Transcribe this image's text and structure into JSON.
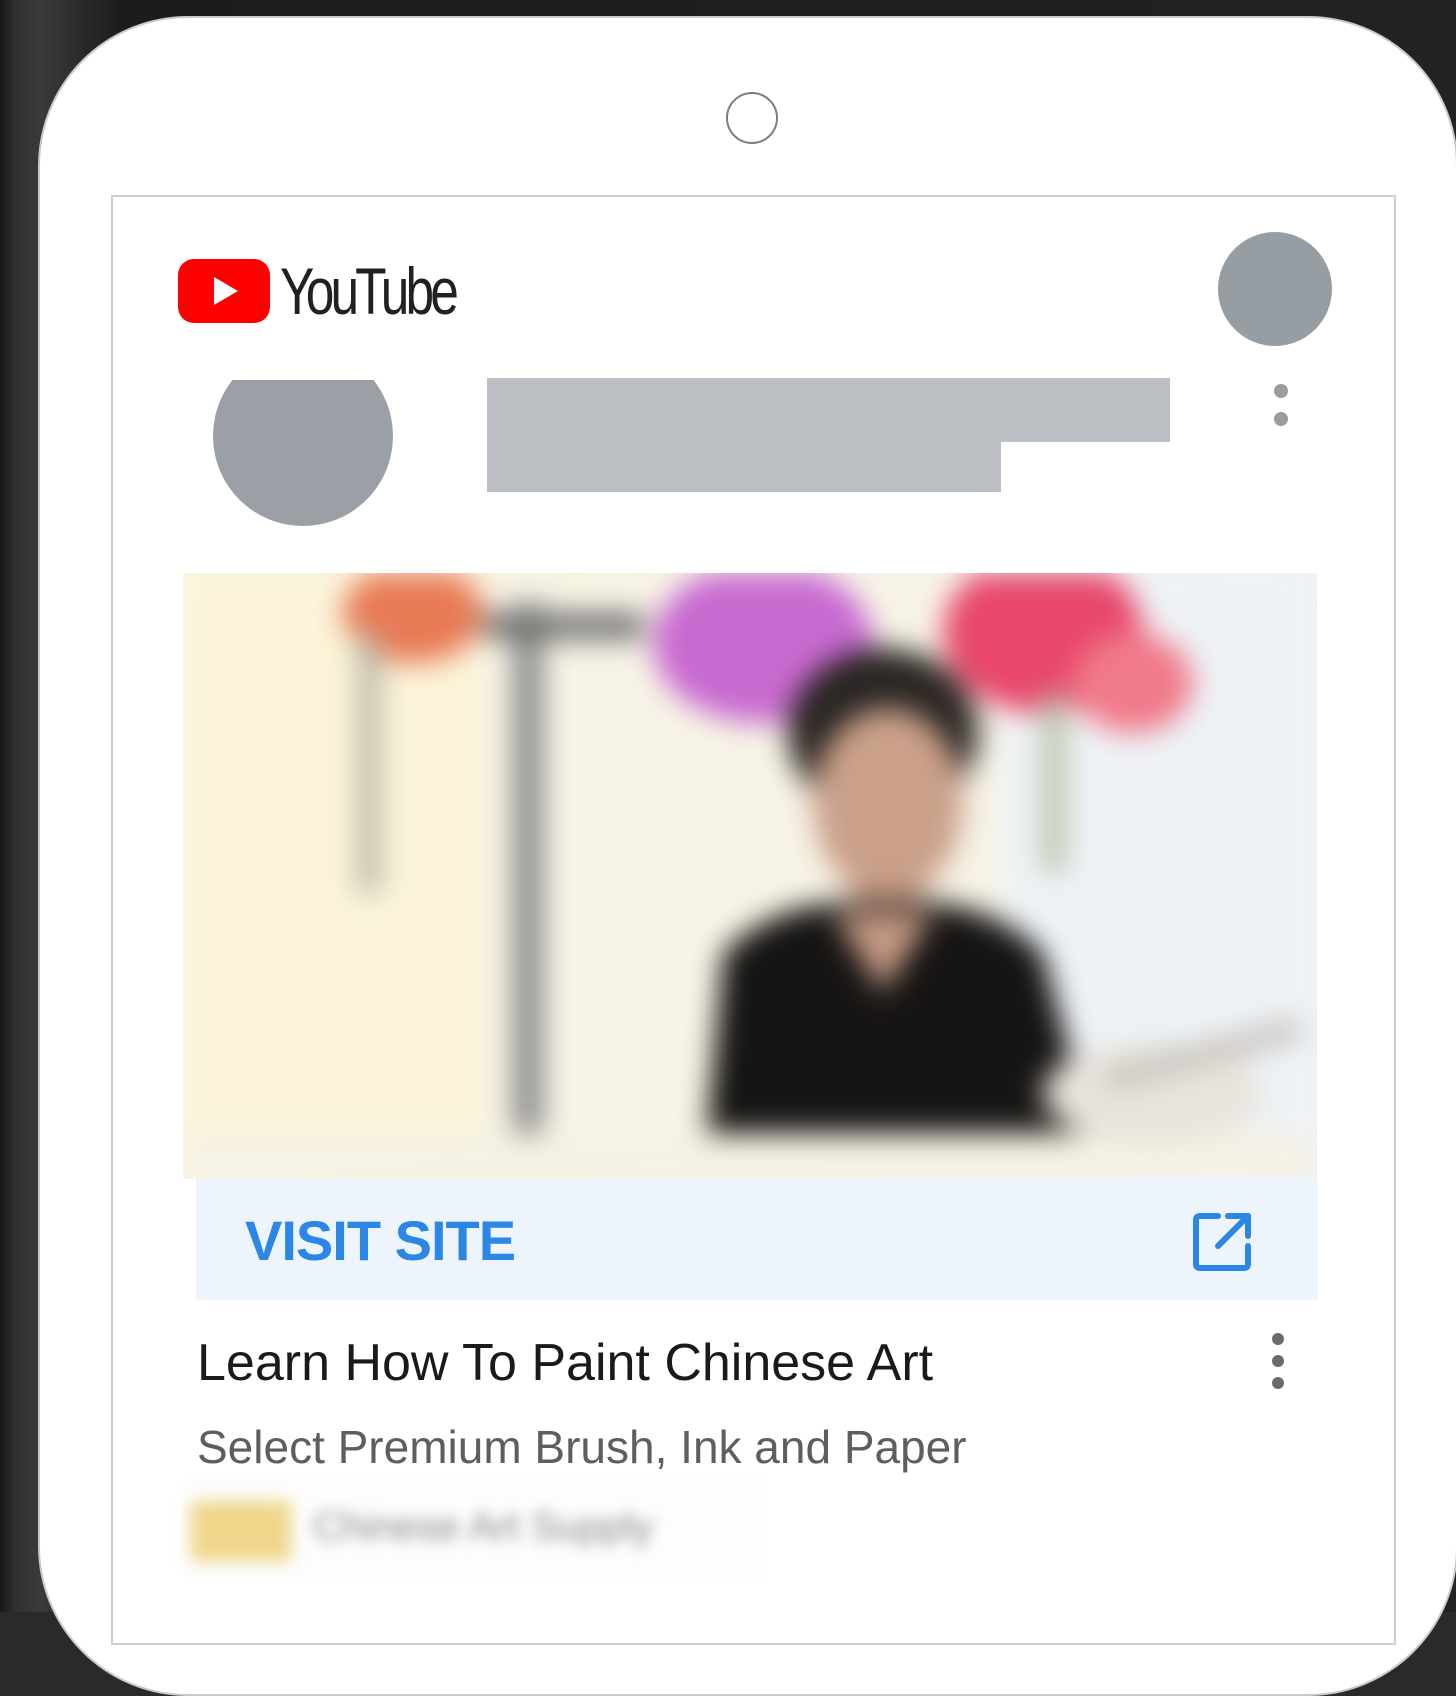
{
  "header": {
    "logo_text": "YouTube"
  },
  "ad": {
    "cta_label": "VISIT SITE",
    "title": "Learn How To Paint Chinese Art",
    "description": "Select Premium Brush, Ink and Paper",
    "advertiser_name": "Chinese Art Supply"
  },
  "colors": {
    "cta_text": "#2b86e6",
    "cta_background": "#eef4fb",
    "youtube_red": "#ff0000",
    "placeholder_gray": "#bcc0c4"
  },
  "icons": {
    "open_external": "external-link-icon",
    "more_menu": "more-vert-icon",
    "play": "play-icon"
  }
}
